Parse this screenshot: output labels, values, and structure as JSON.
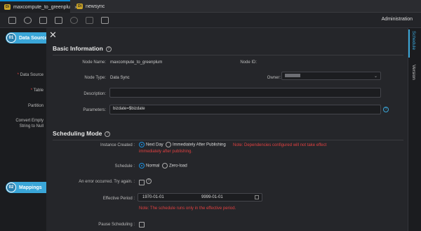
{
  "tabs": [
    {
      "badge": "Di",
      "label": "maxcompute_to_greenplu",
      "close": "×"
    },
    {
      "badge": "Di",
      "label": "newsync",
      "close": ""
    }
  ],
  "toolbar": {
    "icons": [
      "save-icon",
      "run-icon",
      "run-params-icon",
      "submit-icon",
      "stop-icon",
      "lock-icon",
      "format-icon"
    ],
    "admin_label": "Administration"
  },
  "left": {
    "step1": {
      "num": "01",
      "label": "Data Source"
    },
    "step2": {
      "num": "02",
      "label": "Mappings"
    },
    "labels": {
      "data_source": "Data Source",
      "table": "Table",
      "partition": "Partition",
      "convert_empty_1": "Convert Empty",
      "convert_empty_2": "String to Null"
    }
  },
  "panel": {
    "close": "✕",
    "basic_title": "Basic Information",
    "node_name_label": "Node Name:",
    "node_name": "maxcompute_to_greenplum",
    "node_id_label": "Node ID:",
    "node_type_label": "Node Type:",
    "node_type": "Data Sync",
    "owner_label": "Owner:",
    "description_label": "Description:",
    "description_value": "",
    "parameters_label": "Parameters:",
    "parameters_value": "bizdate=$bizdate",
    "scheduling_title": "Scheduling Mode",
    "instance_created_label": "Instance Created :",
    "next_day": "Next Day",
    "immediately": "Immediately After Publishing",
    "note_deps_1": "Note: Dependencies configured will not take effect",
    "note_deps_2": "immediately after publishing.",
    "schedule_label": "Schedule :",
    "normal": "Normal",
    "zero_load": "Zero-load",
    "error_label": "An error occurred. Try again. :",
    "effective_label": "Effective Period :",
    "date_start": "1970-01-01",
    "date_end": "9999-01-01",
    "note_period": "Note: The schedule runs only in the effective period.",
    "pause_label": "Pause Scheduling :"
  },
  "rightbar": {
    "schedule": "Schedule",
    "version": "Version"
  },
  "colors": {
    "accent": "#3aa6d8",
    "error": "#e04040",
    "radio": "#1c8fdc"
  }
}
